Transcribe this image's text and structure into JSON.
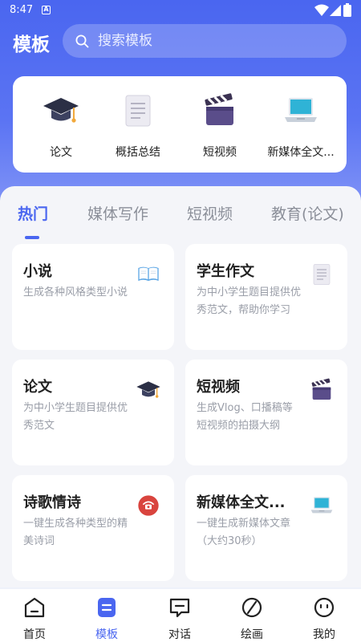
{
  "status_bar": {
    "time": "8:47",
    "notification_badge": "A"
  },
  "header": {
    "title": "模板",
    "search": {
      "placeholder": "搜索模板"
    }
  },
  "features": [
    {
      "label": "论文",
      "icon": "graduation-cap-icon"
    },
    {
      "label": "概括总结",
      "icon": "document-icon"
    },
    {
      "label": "短视频",
      "icon": "clapperboard-icon"
    },
    {
      "label": "新媒体全文...",
      "icon": "laptop-icon"
    }
  ],
  "tabs": [
    {
      "label": "热门",
      "active": true
    },
    {
      "label": "媒体写作"
    },
    {
      "label": "短视频"
    },
    {
      "label": "教育(论文)"
    }
  ],
  "templates": [
    {
      "title": "小说",
      "desc": "生成各种风格类型小说",
      "icon": "book-icon"
    },
    {
      "title": "学生作文",
      "desc": "为中小学生题目提供优秀范文，帮助你学习",
      "icon": "document-icon"
    },
    {
      "title": "论文",
      "desc": "为中小学生题目提供优秀范文",
      "icon": "graduation-cap-icon"
    },
    {
      "title": "短视频",
      "desc": "生成Vlog、口播稿等短视频的拍摄大纲",
      "icon": "clapperboard-icon"
    },
    {
      "title": "诗歌情诗",
      "desc": "一键生成各种类型的精美诗词",
      "icon": "poem-badge-icon"
    },
    {
      "title": "新媒体全文...",
      "desc": "一键生成新媒体文章（大约30秒）",
      "icon": "laptop-icon"
    }
  ],
  "bottom_nav": [
    {
      "label": "首页",
      "icon": "home-icon"
    },
    {
      "label": "模板",
      "icon": "template-icon",
      "active": true
    },
    {
      "label": "对话",
      "icon": "chat-icon"
    },
    {
      "label": "绘画",
      "icon": "paint-icon"
    },
    {
      "label": "我的",
      "icon": "profile-icon"
    }
  ],
  "colors": {
    "accent": "#4a66f0",
    "background": "#f4f5f9"
  }
}
